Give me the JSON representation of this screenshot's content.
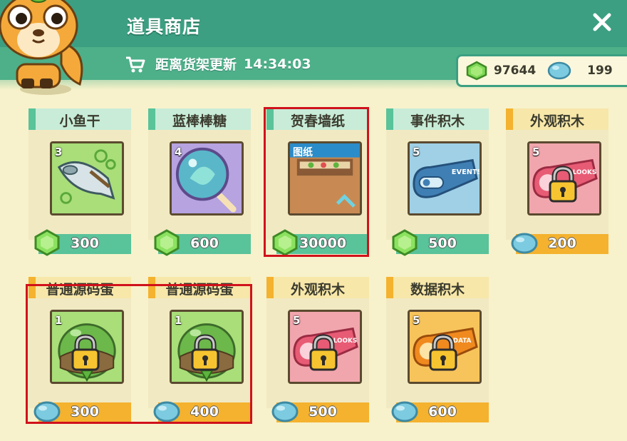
{
  "header": {
    "title": "道具商店",
    "refresh_label": "距离货架更新",
    "refresh_time": "14:34:03"
  },
  "currency": {
    "gems": "97644",
    "beans": "199"
  },
  "items": [
    {
      "name": "小鱼干",
      "qty": "3",
      "price": "300",
      "currency": "gem",
      "icon": "dried-fish"
    },
    {
      "name": "蓝棒棒糖",
      "qty": "4",
      "price": "600",
      "currency": "gem",
      "icon": "blue-lollipop"
    },
    {
      "name": "贺春墙纸",
      "qty": "",
      "tag": "图纸",
      "price": "30000",
      "currency": "gem",
      "icon": "wallpaper-blueprint"
    },
    {
      "name": "事件积木",
      "qty": "5",
      "price": "500",
      "currency": "gem",
      "icon": "events-block"
    },
    {
      "name": "外观积木",
      "qty": "5",
      "price": "200",
      "currency": "bean",
      "icon": "looks-block-locked"
    },
    {
      "name": "普通源码蛋",
      "qty": "1",
      "price": "300",
      "currency": "bean",
      "icon": "egg-locked"
    },
    {
      "name": "普通源码蛋",
      "qty": "1",
      "price": "400",
      "currency": "bean",
      "icon": "egg-locked"
    },
    {
      "name": "外观积木",
      "qty": "5",
      "price": "500",
      "currency": "bean",
      "icon": "looks-block-locked"
    },
    {
      "name": "数据积木",
      "qty": "5",
      "price": "600",
      "currency": "bean",
      "icon": "data-block-locked"
    }
  ],
  "colors": {
    "header": "#3c9f82",
    "gem_bar": "#59c39a",
    "bean_bar": "#f4b22e",
    "highlight": "#d0121b"
  }
}
